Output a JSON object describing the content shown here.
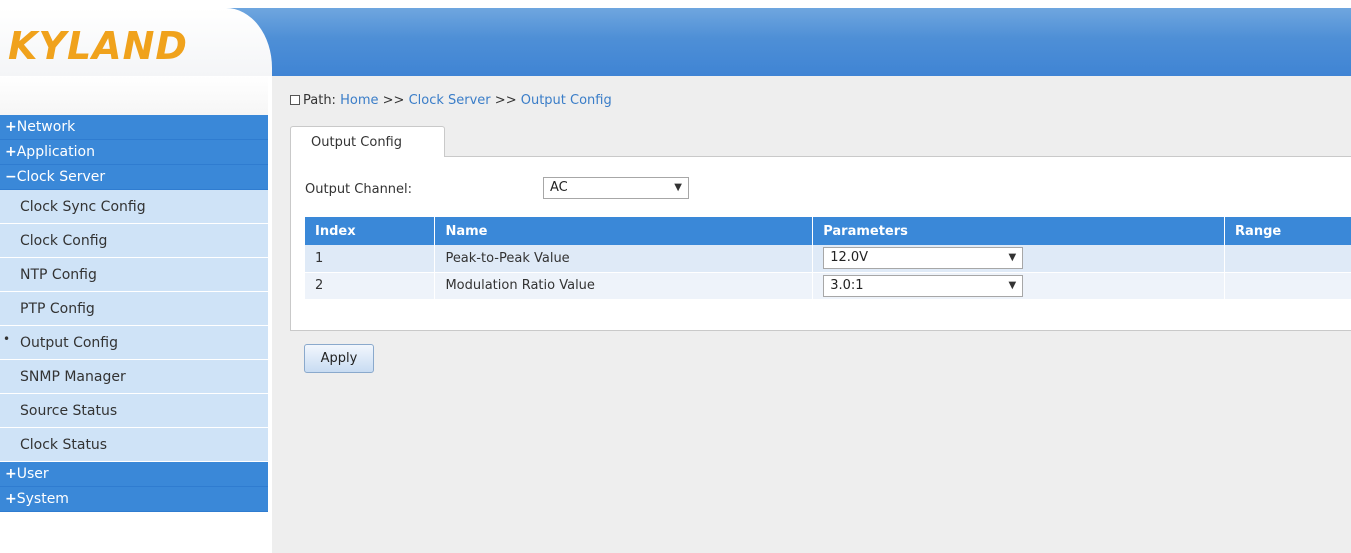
{
  "brand": {
    "logo_text": "KYLAND",
    "logo_color": "#f0a21c",
    "accent": "#3a88d8"
  },
  "sidebar": {
    "categories_top": [
      {
        "sign": "+",
        "label": "Network"
      },
      {
        "sign": "+",
        "label": "Application"
      },
      {
        "sign": "−",
        "label": "Clock Server"
      }
    ],
    "items": [
      {
        "label": "Clock Sync Config"
      },
      {
        "label": "Clock Config"
      },
      {
        "label": "NTP Config"
      },
      {
        "label": "PTP Config"
      },
      {
        "label": "Output Config",
        "active": true
      },
      {
        "label": "SNMP Manager"
      },
      {
        "label": "Source Status"
      },
      {
        "label": "Clock Status"
      }
    ],
    "categories_bottom": [
      {
        "sign": "+",
        "label": "User"
      },
      {
        "sign": "+",
        "label": "System"
      }
    ]
  },
  "breadcrumb": {
    "prefix": "Path:",
    "home": "Home",
    "separator": ">>",
    "section": "Clock Server",
    "page": "Output Config"
  },
  "tab": {
    "label": "Output Config"
  },
  "form": {
    "channel_label": "Output Channel:",
    "channel_value": "AC"
  },
  "table": {
    "headers": {
      "index": "Index",
      "name": "Name",
      "parameters": "Parameters",
      "range": "Range"
    },
    "rows": [
      {
        "index": "1",
        "name": "Peak-to-Peak Value",
        "value": "12.0V",
        "range": ""
      },
      {
        "index": "2",
        "name": "Modulation Ratio Value",
        "value": "3.0:1",
        "range": ""
      }
    ]
  },
  "actions": {
    "apply_label": "Apply"
  }
}
